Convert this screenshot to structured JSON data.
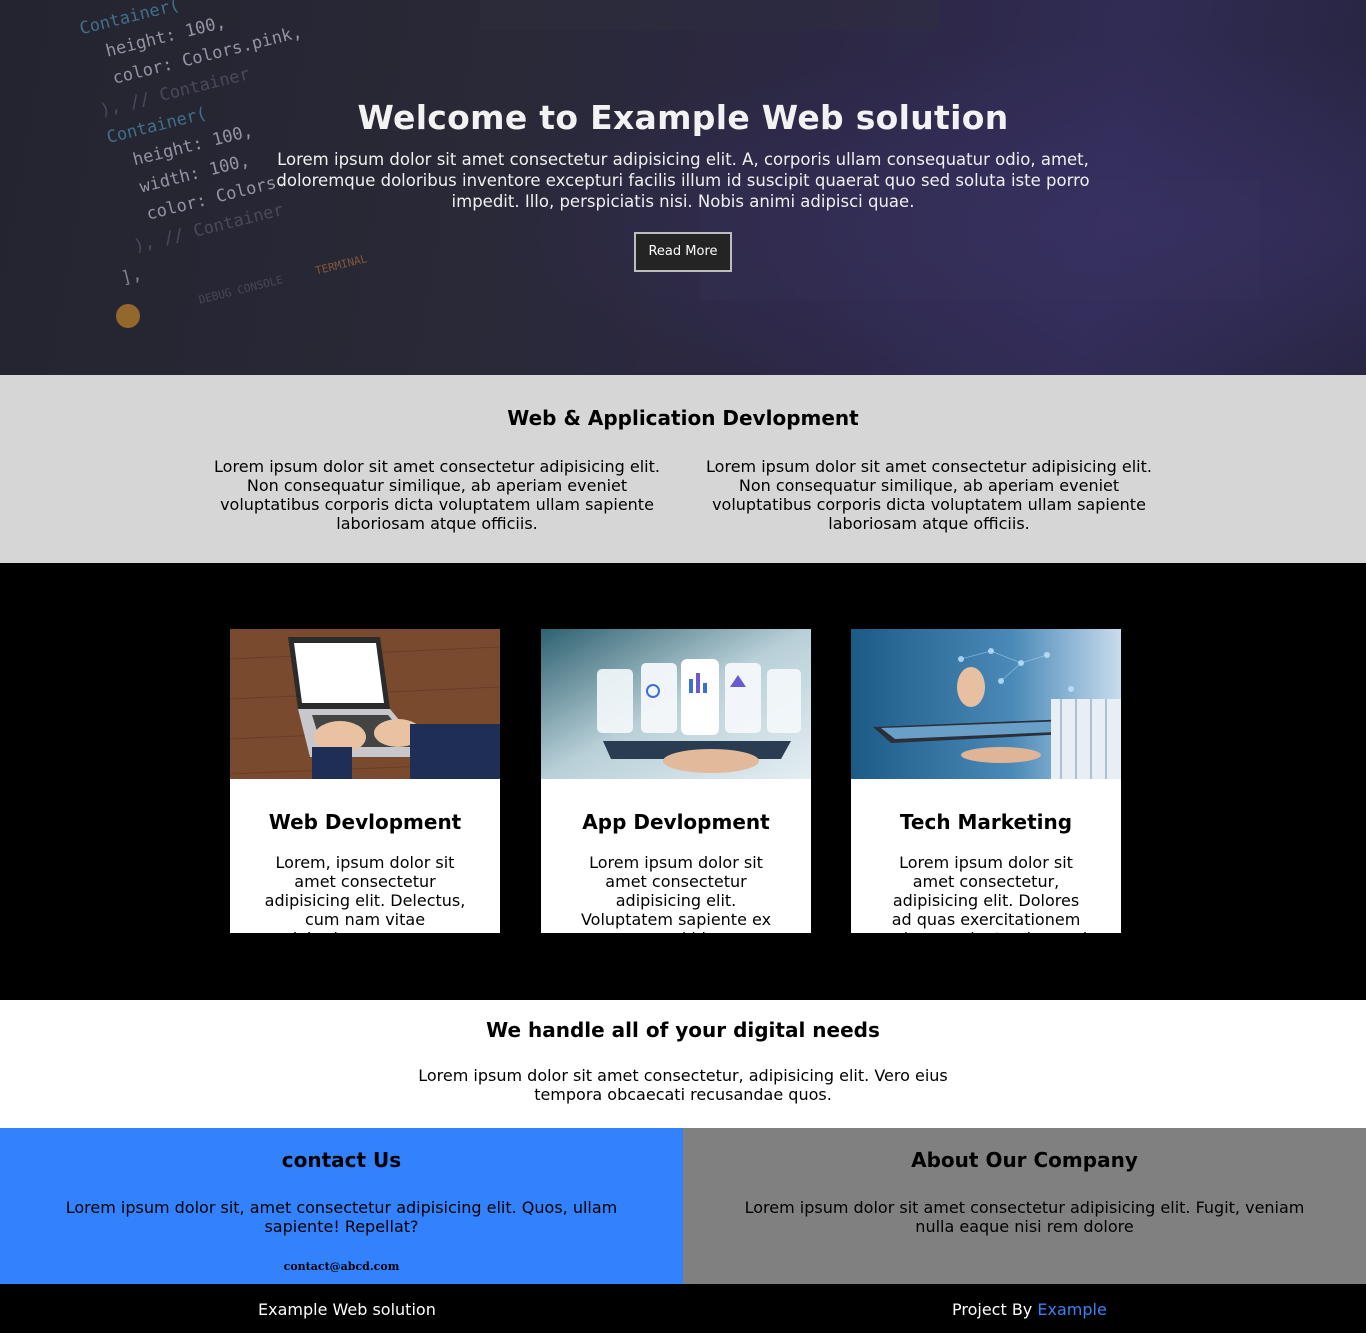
{
  "hero": {
    "title": "Welcome to Example Web solution",
    "text": "Lorem ipsum dolor sit amet consectetur adipisicing elit. A, corporis ullam consequatur odio, amet, doloremque doloribus inventore excepturi facilis illum id suscipit quaerat quo sed soluta iste porro impedit. Illo, perspiciatis nisi. Nobis animi adipisci quae.",
    "button": "Read More"
  },
  "intro": {
    "title": "Web & Application Devlopment",
    "columns": [
      "Lorem ipsum dolor sit amet consectetur adipisicing elit. Non consequatur similique, ab aperiam eveniet voluptatibus corporis dicta voluptatem ullam sapiente laboriosam atque officiis.",
      "Lorem ipsum dolor sit amet consectetur adipisicing elit. Non consequatur similique, ab aperiam eveniet voluptatibus corporis dicta voluptatem ullam sapiente laboriosam atque officiis."
    ]
  },
  "cards": [
    {
      "title": "Web Devlopment",
      "text": "Lorem, ipsum dolor sit amet consectetur adipisicing elit. Delectus, cum nam vitae laboriosam, quam"
    },
    {
      "title": "App Devlopment",
      "text": "Lorem ipsum dolor sit amet consectetur adipisicing elit. Voluptatem sapiente ex quod id"
    },
    {
      "title": "Tech Marketing",
      "text": "Lorem ipsum dolor sit amet consectetur, adipisicing elit. Dolores ad quas exercitationem culpa nesciunt quis quasi"
    }
  ],
  "digital": {
    "title": "We handle all of your digital needs",
    "text": "Lorem ipsum dolor sit amet consectetur, adipisicing elit. Vero eius tempora obcaecati recusandae quos."
  },
  "contact": {
    "title": "contact Us",
    "text": "Lorem ipsum dolor sit, amet consectetur adipisicing elit. Quos, ullam sapiente! Repellat?",
    "email": "contact@abcd.com"
  },
  "about": {
    "title": "About Our Company",
    "text": "Lorem ipsum dolor sit amet consectetur adipisicing elit. Fugit, veniam nulla eaque nisi rem dolore"
  },
  "footer": {
    "brand": "Example Web solution",
    "project_by": "Project By",
    "link": "Example"
  },
  "colors": {
    "contact_bg": "#3282fe",
    "about_bg": "#808080",
    "intro_bg": "#d6d6d6",
    "footer_link": "#3b82f6"
  }
}
